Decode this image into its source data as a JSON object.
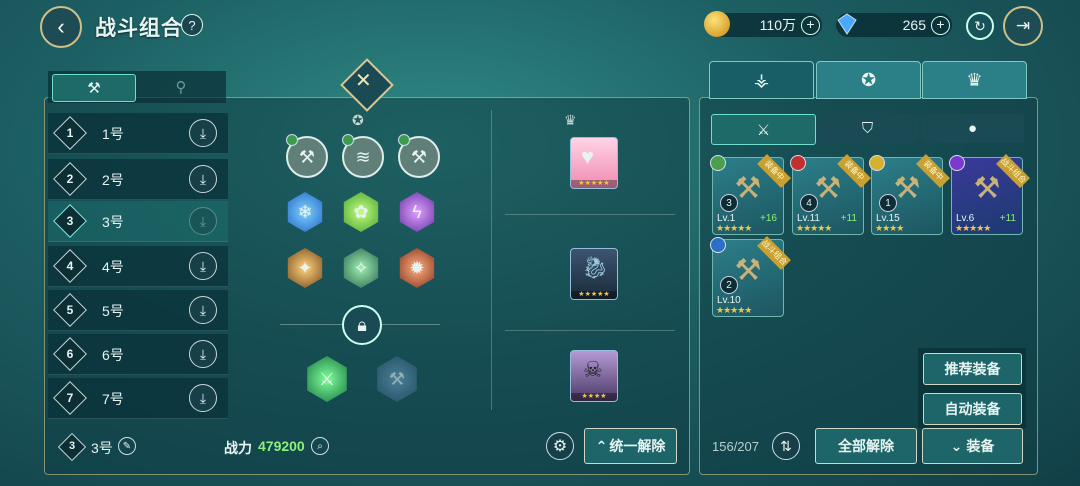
{
  "header": {
    "back_icon": "back-arrow-icon",
    "title": "战斗组合",
    "help": "?"
  },
  "currencies": {
    "gold": "110万",
    "gems": "265"
  },
  "left_tabs": {
    "a_icon": "hammer-icon",
    "b_icon": "tool-icon"
  },
  "presets": [
    {
      "num": "1",
      "label": "1号"
    },
    {
      "num": "2",
      "label": "2号"
    },
    {
      "num": "3",
      "label": "3号"
    },
    {
      "num": "4",
      "label": "4号"
    },
    {
      "num": "5",
      "label": "5号"
    },
    {
      "num": "6",
      "label": "6号"
    },
    {
      "num": "7",
      "label": "7号"
    }
  ],
  "selected_preset": {
    "num": "3",
    "label": "3号"
  },
  "power": {
    "label": "战力",
    "value": "479200"
  },
  "unequip_one": "统一解除",
  "sub_tabs_icons": [
    "sword-icon",
    "shield-icon",
    "orb-icon"
  ],
  "weapons": [
    {
      "lv": "Lv.1",
      "bonus": "+16",
      "badge": "装备中",
      "num": "3",
      "stars": "★★★★★"
    },
    {
      "lv": "Lv.11",
      "bonus": "+11",
      "badge": "装备中",
      "num": "4",
      "stars": "★★★★★"
    },
    {
      "lv": "Lv.15",
      "bonus": "",
      "badge": "装备中",
      "num": "1",
      "stars": "★★★★"
    },
    {
      "lv": "Lv.6",
      "bonus": "+11",
      "badge": "战斗组合",
      "num": "",
      "stars": "★★★★★"
    },
    {
      "lv": "Lv.10",
      "bonus": "",
      "badge": "战斗组合",
      "num": "2",
      "stars": "★★★★★"
    }
  ],
  "inventory_count": "156/207",
  "recommend_btn": "推荐装备",
  "auto_btn": "自动装备",
  "unequip_all": "全部解除",
  "equip_btn": "装备"
}
